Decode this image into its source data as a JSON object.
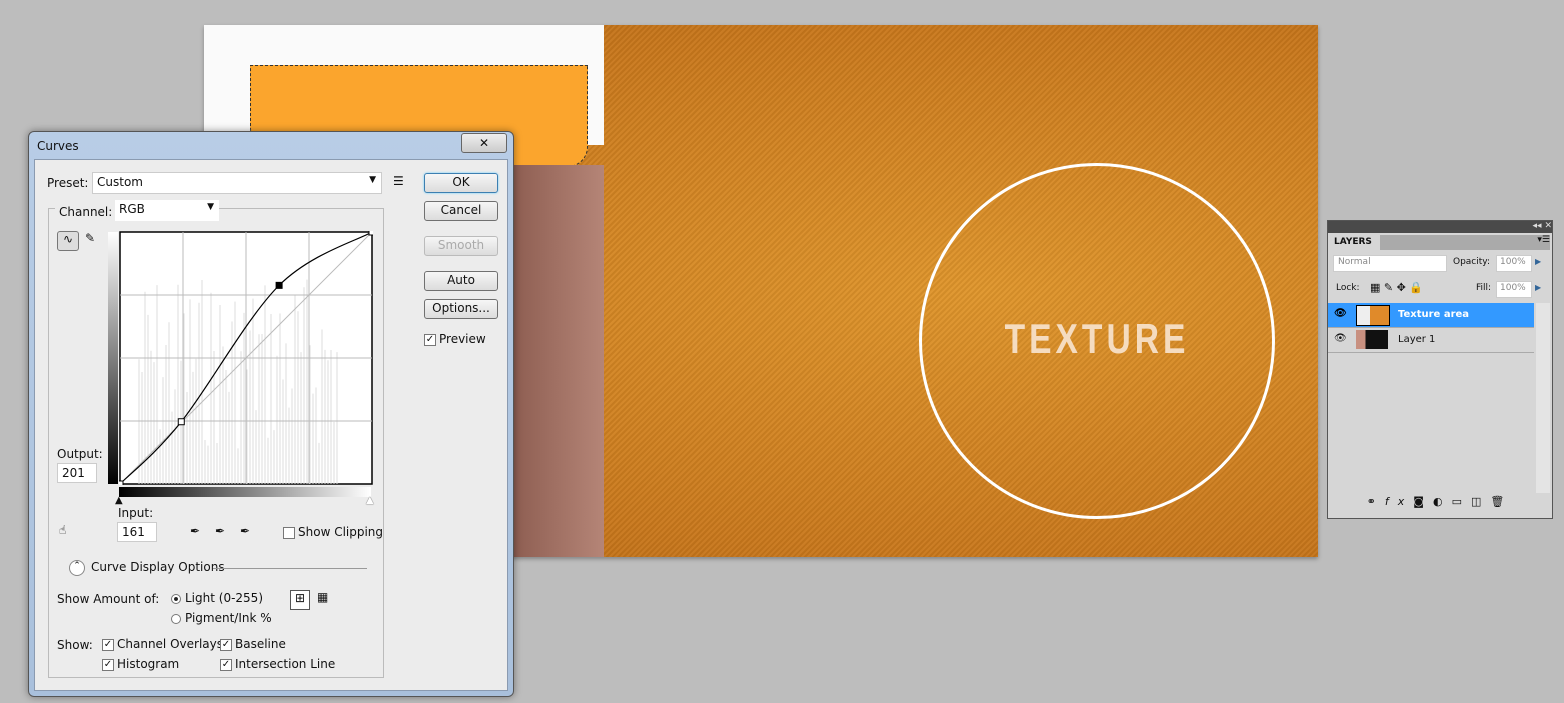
{
  "canvas": {
    "overlay_text": "TEXTURE"
  },
  "curves": {
    "title": "Curves",
    "close": "✕",
    "preset_label": "Preset:",
    "preset_value": "Custom",
    "channel_label": "Channel:",
    "channel_value": "RGB",
    "output_label": "Output:",
    "output_value": "201",
    "input_label": "Input:",
    "input_value": "161",
    "buttons": {
      "ok": "OK",
      "cancel": "Cancel",
      "smooth": "Smooth",
      "auto": "Auto",
      "options": "Options..."
    },
    "preview_label": "Preview",
    "preview_checked": true,
    "show_clipping_label": "Show Clipping",
    "curve_display_options": "Curve Display Options",
    "show_amount_label": "Show Amount of:",
    "light_label": "Light  (0-255)",
    "pigment_label": "Pigment/Ink %",
    "show_label": "Show:",
    "channel_overlays": "Channel Overlays",
    "baseline": "Baseline",
    "histogram": "Histogram",
    "intersection_line": "Intersection Line",
    "curve_points": [
      [
        0,
        0
      ],
      [
        62,
        63
      ],
      [
        161,
        201
      ],
      [
        255,
        255
      ]
    ]
  },
  "layers": {
    "tab": "LAYERS",
    "blend_mode": "Normal",
    "opacity_label": "Opacity:",
    "opacity": "100%",
    "lock_label": "Lock:",
    "fill_label": "Fill:",
    "fill": "100%",
    "items": [
      {
        "name": "Texture area",
        "selected": true
      },
      {
        "name": "Layer 1",
        "selected": false
      }
    ],
    "selected_color": "#3399ff"
  }
}
